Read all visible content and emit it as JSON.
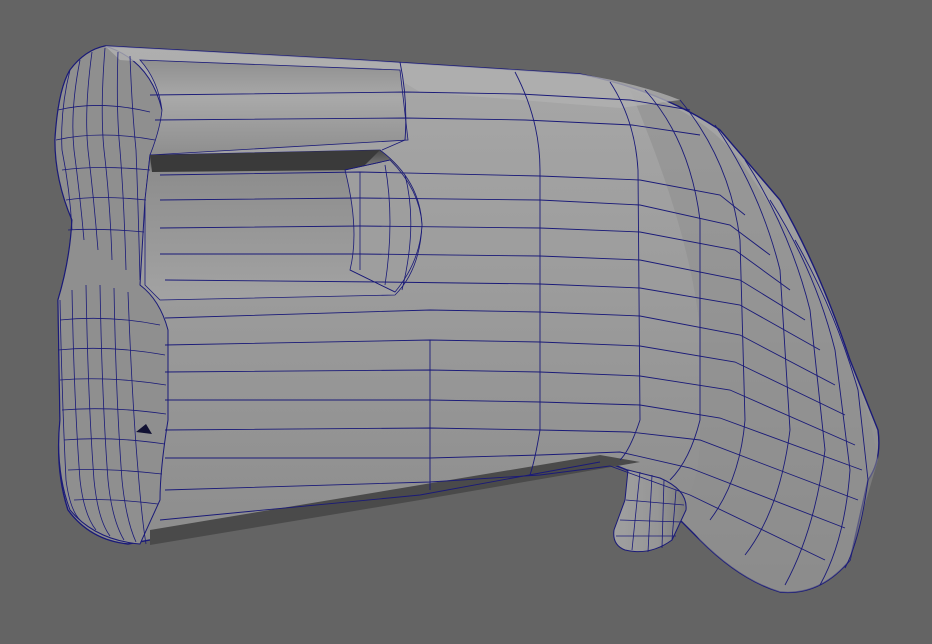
{
  "viewport": {
    "background_color": "#646464",
    "mesh_fill_color": "#9a9a9a",
    "mesh_shadow_color": "#6e6e6e",
    "mesh_dark_color": "#3c3c3c",
    "wireframe_color": "#1a1a78",
    "subject": "mesh-3d-model"
  }
}
